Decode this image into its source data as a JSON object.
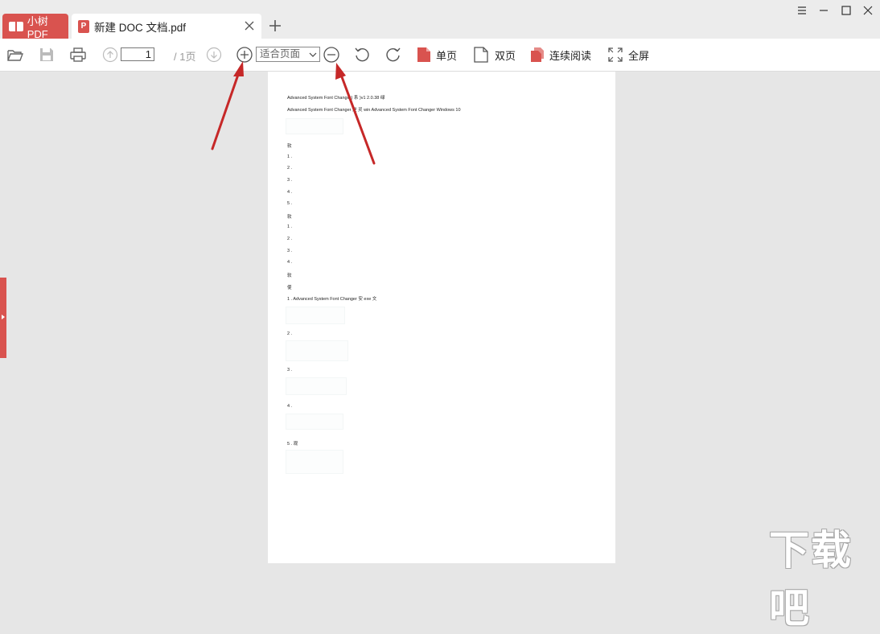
{
  "tabs": {
    "app_label": "小树PDF",
    "doc_label": "新建 DOC 文档.pdf",
    "doc_badge": "P"
  },
  "toolbar": {
    "page_current": "1",
    "page_total": "/ 1页",
    "zoom_value": "适合页面",
    "single_page": "单页",
    "double_page": "双页",
    "continuous": "连续阅读",
    "fullscreen": "全屏"
  },
  "document": {
    "lines": [
      "Advanced System Font Changer) 系 )v1 2.0.38 绿",
      "Advanced System Font Changer 是 灵 win Advanced System Font Changer Windows 10",
      "软",
      "1 .",
      "2 .",
      "3 .",
      "4 .",
      "5 .",
      "软",
      "1 .",
      "2 .",
      "3 .",
      "4 .",
      "软",
      "使",
      "1 .  Advanced System Font Changer 安 exe 文",
      "2 .",
      "3 .",
      "4 .",
      "5 . 观"
    ]
  },
  "watermark": "下载吧",
  "colors": {
    "accent": "#d9534f",
    "annotation_arrow": "#c62828"
  }
}
